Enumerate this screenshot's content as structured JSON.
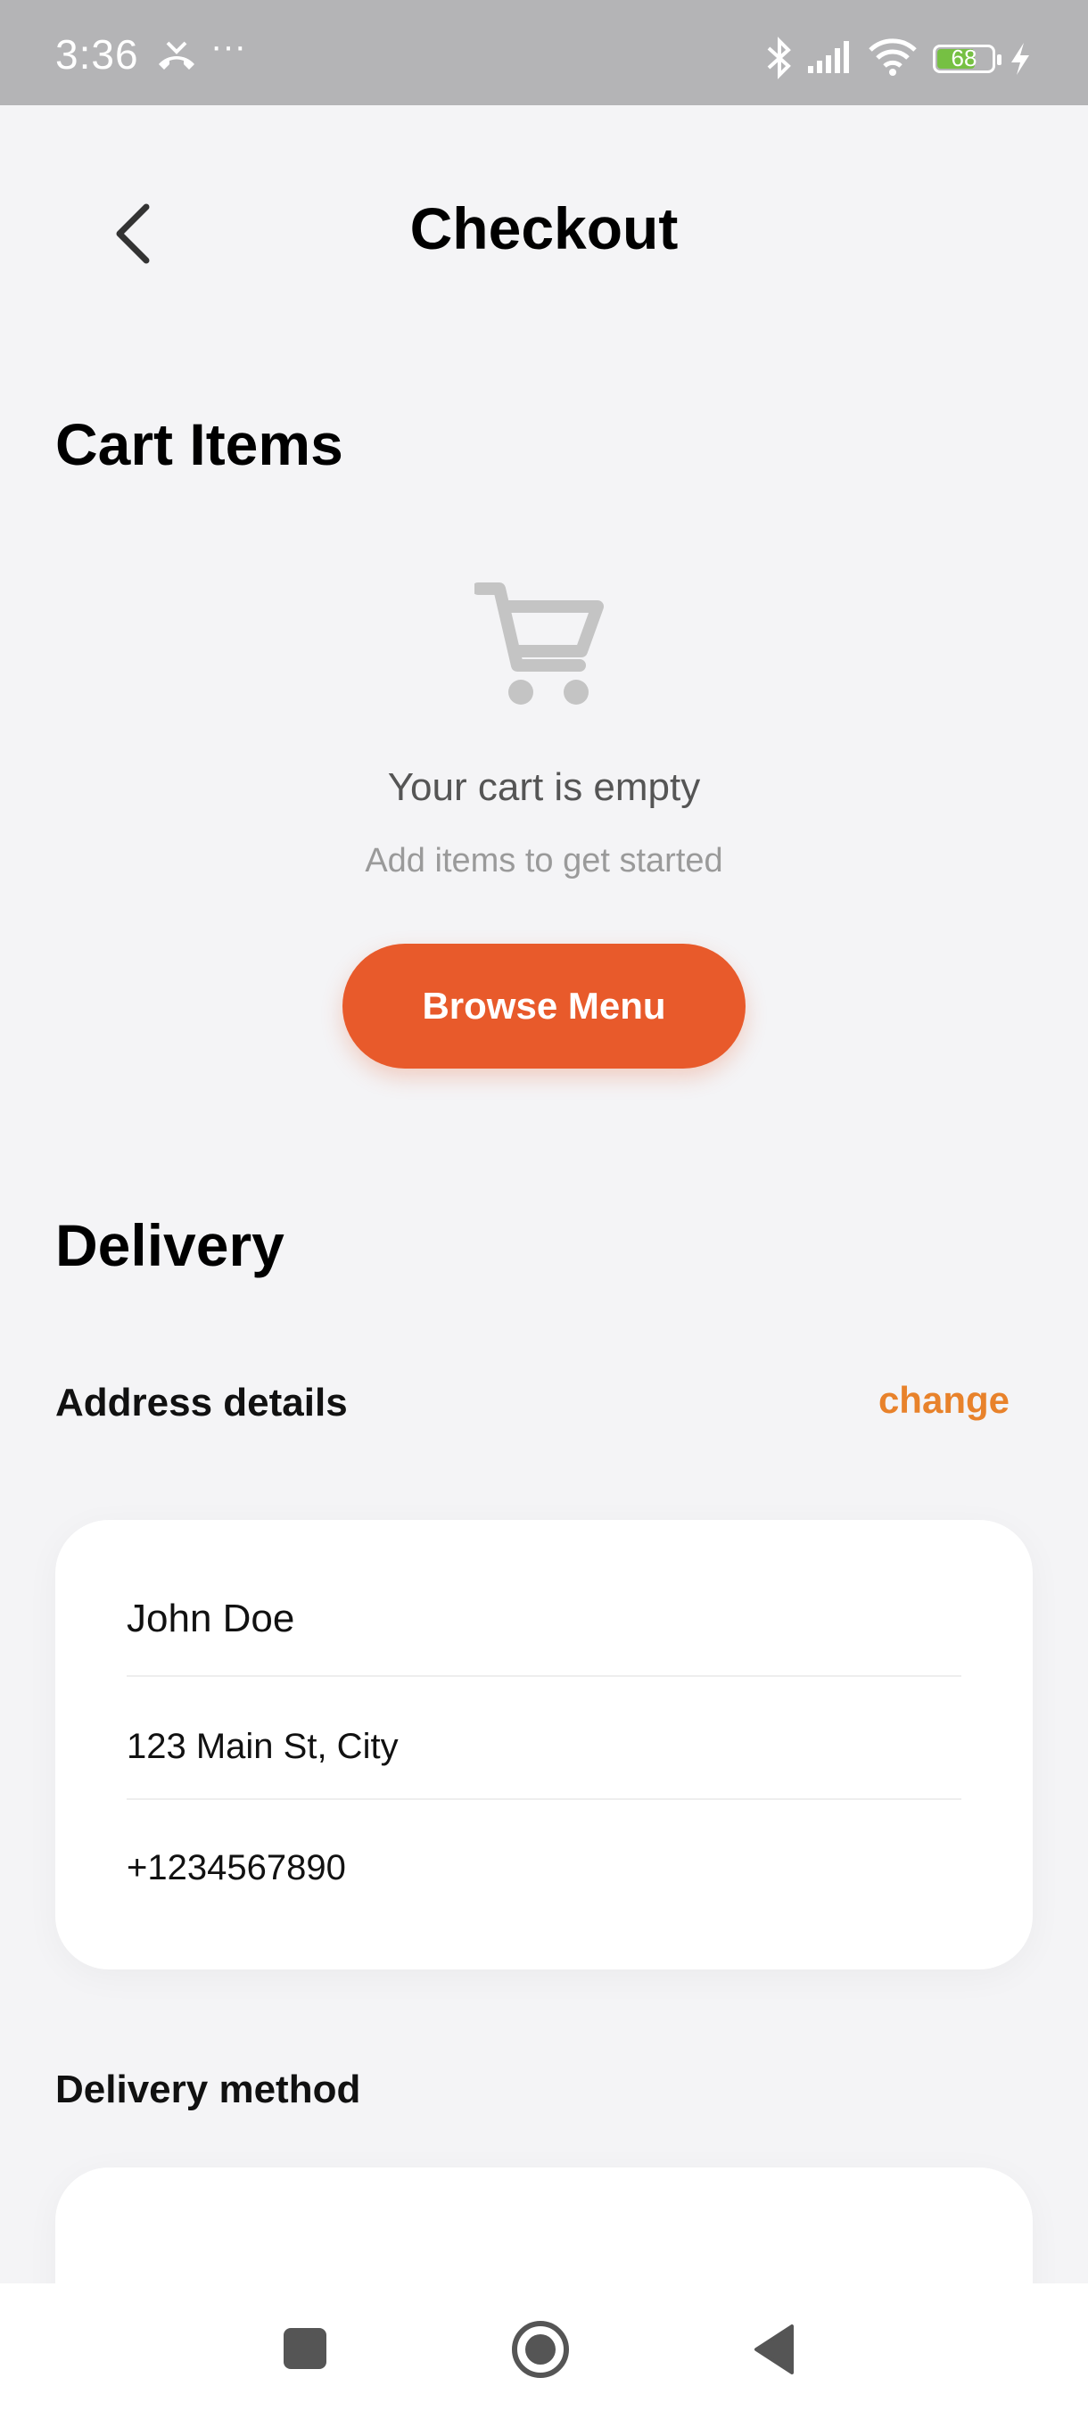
{
  "status_bar": {
    "time": "3:36",
    "dots": "···",
    "battery": "68"
  },
  "header": {
    "title": "Checkout",
    "back_icon": "chevron-left-icon"
  },
  "cart": {
    "section_title": "Cart Items",
    "empty_icon": "cart-icon",
    "empty_title": "Your cart is empty",
    "empty_subtitle": "Add items to get started",
    "browse_label": "Browse Menu"
  },
  "delivery": {
    "section_title": "Delivery",
    "address_label": "Address details",
    "change_label": "change",
    "address": {
      "name": "John Doe",
      "street": "123 Main St, City",
      "phone": "+1234567890"
    },
    "method_label": "Delivery method"
  },
  "colors": {
    "accent": "#E85A2B",
    "link": "#E8822B",
    "background": "#F4F4F6"
  }
}
